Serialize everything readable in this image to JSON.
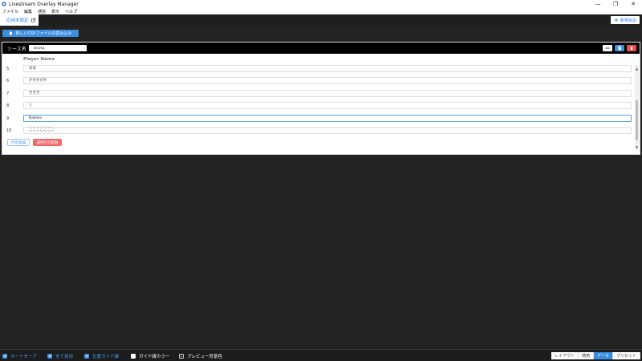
{
  "window": {
    "title": "Livestream Overlay Manager",
    "controls": {
      "minimize": "—",
      "restore": "❐",
      "close": "✕"
    }
  },
  "menu": [
    "ファイル",
    "編集",
    "通信",
    "表示",
    "ヘルプ"
  ],
  "tab": {
    "label": "応用未設定",
    "icon": "edit-icon"
  },
  "toolbar": {
    "add_window_label": "新規追加"
  },
  "load_csv": {
    "label": "新しいCSVファイルの読み込み"
  },
  "panel": {
    "source_label": "ソース名",
    "source_value": "Book1",
    "column_header": "Player Name",
    "rows": [
      {
        "num": "5",
        "value": "おお"
      },
      {
        "num": "6",
        "value": "かかかかか"
      },
      {
        "num": "7",
        "value": "ききき"
      },
      {
        "num": "8",
        "value": "く"
      },
      {
        "num": "9",
        "value": "Bakeko",
        "focused": true
      },
      {
        "num": "10",
        "value": "こここここここ"
      }
    ],
    "add_row_label": "行の追加",
    "delete_row_label": "選択行の削除",
    "header_buttons": [
      "minus-icon",
      "copy-icon",
      "trash-icon"
    ]
  },
  "bottom": {
    "options": [
      {
        "label": "オートセーブ",
        "checked": true
      },
      {
        "label": "全て有効",
        "checked": true
      },
      {
        "label": "位置ガイド線",
        "checked": true
      },
      {
        "label": "ガイド線カラー",
        "checked": false,
        "swatch": "#ffffff"
      },
      {
        "label": "プレビュー背景色",
        "checked": false,
        "swatch": "#222222"
      }
    ],
    "segments": [
      {
        "label": "レイアウト",
        "active": false
      },
      {
        "label": "適用",
        "active": false
      },
      {
        "label": "データ",
        "active": true
      },
      {
        "label": "プリセット",
        "active": false
      }
    ]
  },
  "colors": {
    "accent": "#3b8de0",
    "danger": "#ef6b6b",
    "background": "#222222"
  }
}
